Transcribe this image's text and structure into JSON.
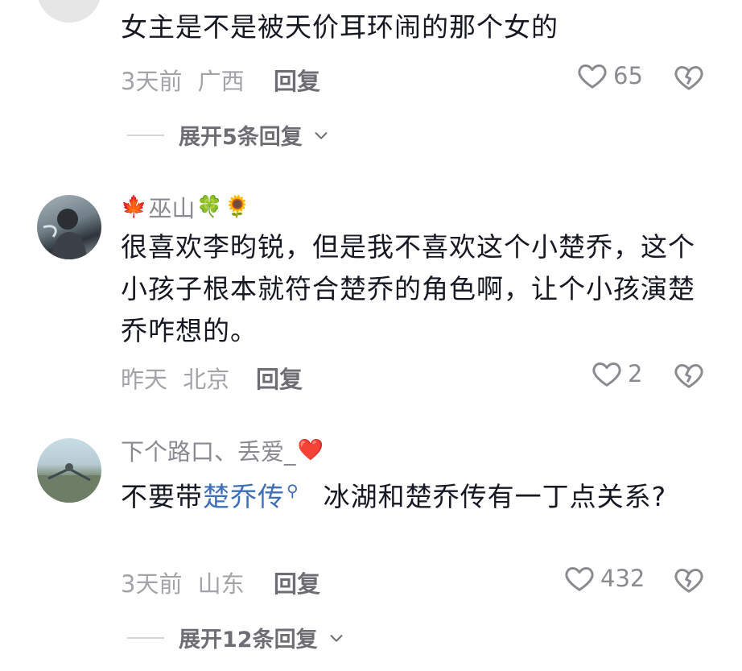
{
  "comments": [
    {
      "text": "女主是不是被天价耳环闹的那个女的",
      "time": "3天前",
      "location": "广西",
      "reply_label": "回复",
      "likes": "65",
      "expand_label": "展开5条回复"
    },
    {
      "username_prefix_emoji": "🍁",
      "username": "巫山",
      "username_suffix_emoji_1": "🍀",
      "username_suffix_emoji_2": "🌻",
      "text": "很喜欢李昀锐，但是我不喜欢这个小楚乔，这个小孩子根本就符合楚乔的角色啊，让个小孩演楚乔咋想的。",
      "time": "昨天",
      "location": "北京",
      "reply_label": "回复",
      "likes": "2"
    },
    {
      "username": "下个路口、丢爱_",
      "username_suffix_emoji_1": "❤️",
      "text_before": "不要带",
      "link_text": "楚乔传",
      "text_after": "冰湖和楚乔传有一丁点关系?",
      "time": "3天前",
      "location": "山东",
      "reply_label": "回复",
      "likes": "432",
      "expand_label": "展开12条回复"
    }
  ],
  "icons": {
    "like": "heart-outline-icon",
    "dislike": "broken-heart-icon",
    "expand": "chevron-down-icon",
    "link_search": "search-icon"
  },
  "colors": {
    "link": "#3f6fb6",
    "meta": "#a3a4a8",
    "text": "#161823"
  }
}
